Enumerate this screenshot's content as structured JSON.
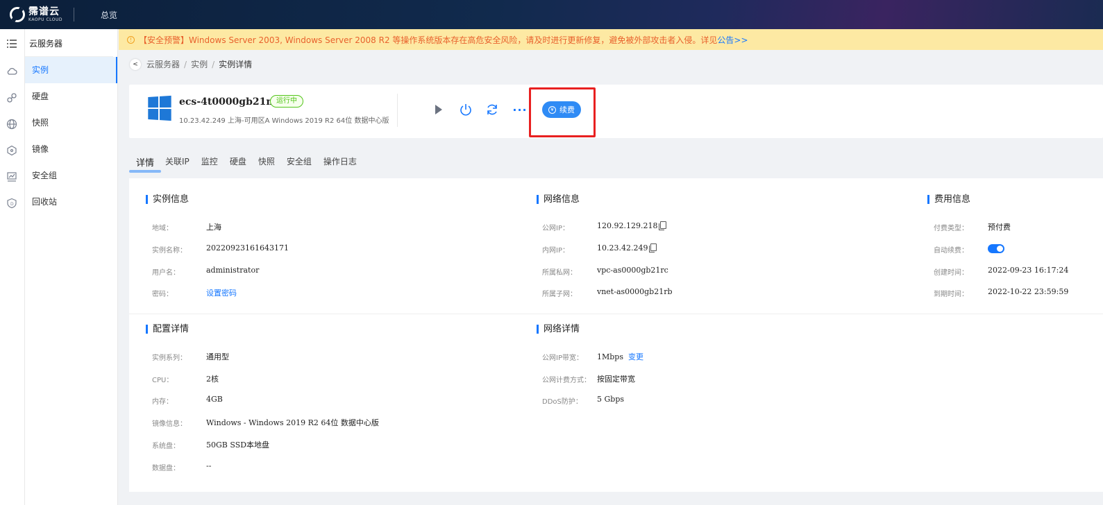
{
  "topbar": {
    "brand_cn": "霈谱云",
    "brand_en": "KAOPU CLOUD",
    "nav_overview": "总览"
  },
  "sidebar": {
    "title": "云服务器",
    "items": [
      {
        "label": "实例",
        "icon": "cloud-icon",
        "active": true
      },
      {
        "label": "硬盘",
        "icon": "disk-link-icon"
      },
      {
        "label": "快照",
        "icon": "globe-icon"
      },
      {
        "label": "镜像",
        "icon": "network-icon"
      },
      {
        "label": "安全组",
        "icon": "monitor-icon"
      },
      {
        "label": "回收站",
        "icon": "shield-icon"
      }
    ]
  },
  "alert": {
    "text": "【安全预警】Windows Server 2003, Windows Server 2008 R2 等操作系统版本存在高危安全风险，请及时进行更新修复，避免被外部攻击者入侵。详见",
    "link": "公告>>"
  },
  "breadcrumb": {
    "back": "<",
    "items": [
      "云服务器",
      "实例"
    ],
    "current": "实例详情",
    "sep": "/"
  },
  "instance": {
    "name": "ecs-4t0000gb21my",
    "status": "运行中",
    "subtitle": "10.23.42.249  上海-可用区A  Windows 2019 R2 64位 数据中心版",
    "renew_label": "续费",
    "more_label": "···"
  },
  "tabs": [
    "详情",
    "关联IP",
    "监控",
    "硬盘",
    "快照",
    "安全组",
    "操作日志"
  ],
  "instance_info": {
    "title": "实例信息",
    "rows": [
      {
        "label": "地域：",
        "value": "上海"
      },
      {
        "label": "实例名称：",
        "value": "20220923161643171"
      },
      {
        "label": "用户名：",
        "value": "administrator"
      },
      {
        "label": "密码：",
        "value": "设置密码"
      }
    ]
  },
  "network_info": {
    "title": "网络信息",
    "rows": [
      {
        "label": "公网IP：",
        "value": "120.92.129.218"
      },
      {
        "label": "内网IP：",
        "value": "10.23.42.249"
      },
      {
        "label": "所属私网：",
        "value": "vpc-as0000gb21rc"
      },
      {
        "label": "所属子网：",
        "value": "vnet-as0000gb21rb"
      }
    ]
  },
  "billing_info": {
    "title": "费用信息",
    "rows": [
      {
        "label": "付费类型：",
        "value": "预付费"
      },
      {
        "label": "自动续费：",
        "value": ""
      },
      {
        "label": "创建时间：",
        "value": "2022-09-23 16:17:24"
      },
      {
        "label": "到期时间：",
        "value": "2022-10-22 23:59:59"
      }
    ],
    "auto_renew_on": true
  },
  "config_detail": {
    "title": "配置详情",
    "rows": [
      {
        "label": "实例系列：",
        "value": "通用型"
      },
      {
        "label": "CPU：",
        "value": "2核"
      },
      {
        "label": "内存：",
        "value": "4GB"
      },
      {
        "label": "镜像信息：",
        "value": "Windows - Windows 2019 R2 64位 数据中心版"
      },
      {
        "label": "系统盘：",
        "value": "50GB SSD本地盘"
      },
      {
        "label": "数据盘：",
        "value": "--"
      }
    ]
  },
  "network_detail": {
    "title": "网络详情",
    "rows": [
      {
        "label": "公网IP带宽：",
        "value": "1Mbps",
        "action": "变更"
      },
      {
        "label": "公网计费方式：",
        "value": "按固定带宽"
      },
      {
        "label": "DDoS防护：",
        "value": "5 Gbps"
      }
    ]
  },
  "colors": {
    "accent": "#1677ff",
    "alert_bg": "#fde9a3",
    "alert_text": "#e8612c",
    "status_green": "#52c41a",
    "highlight": "#e82020"
  }
}
